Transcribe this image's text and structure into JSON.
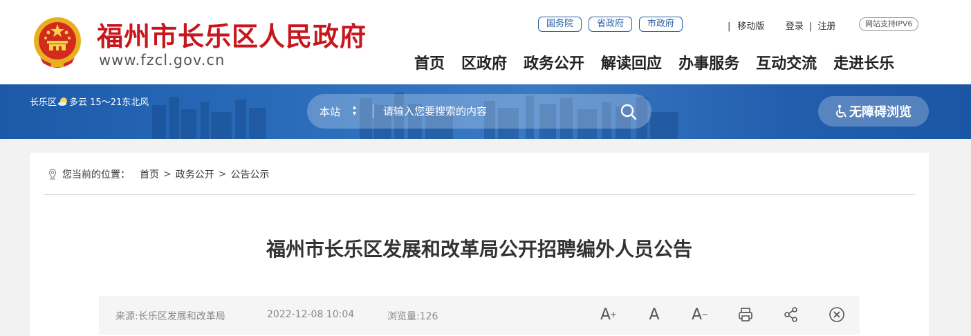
{
  "header": {
    "site_title": "福州市长乐区人民政府",
    "site_url": "www.fzcl.gov.cn",
    "gov_links": [
      "国务院",
      "省政府",
      "市政府"
    ],
    "util": {
      "sep": "|",
      "mobile": "移动版",
      "login": "登录",
      "register": "注册"
    },
    "ipv6": "网站支持IPV6",
    "nav": [
      "首页",
      "区政府",
      "政务公开",
      "解读回应",
      "办事服务",
      "互动交流",
      "走进长乐"
    ],
    "colors": {
      "brand_red": "#c8161d",
      "link_blue": "#2a5fa5"
    }
  },
  "banner": {
    "location": "长乐区",
    "weather_icon": "partly-cloudy-icon",
    "weather": "多云 15～21东北风",
    "search": {
      "scope": "本站",
      "placeholder": "请输入您要搜索的内容",
      "value": ""
    },
    "accessibility": "无障碍浏览",
    "colors": {
      "banner_blue": "#235fae"
    }
  },
  "breadcrumb": {
    "label": "您当前的位置：",
    "items": [
      "首页",
      "政务公开",
      "公告公示"
    ],
    "sep": ">"
  },
  "article": {
    "title": "福州市长乐区发展和改革局公开招聘编外人员公告",
    "source": "来源:长乐区发展和改革局",
    "date": "2022-12-08 10:04",
    "views": "浏览量:126",
    "tools": {
      "font_larger": "A",
      "font_normal": "A",
      "font_smaller": "A",
      "larger_mark": "+",
      "smaller_mark": "−"
    }
  }
}
